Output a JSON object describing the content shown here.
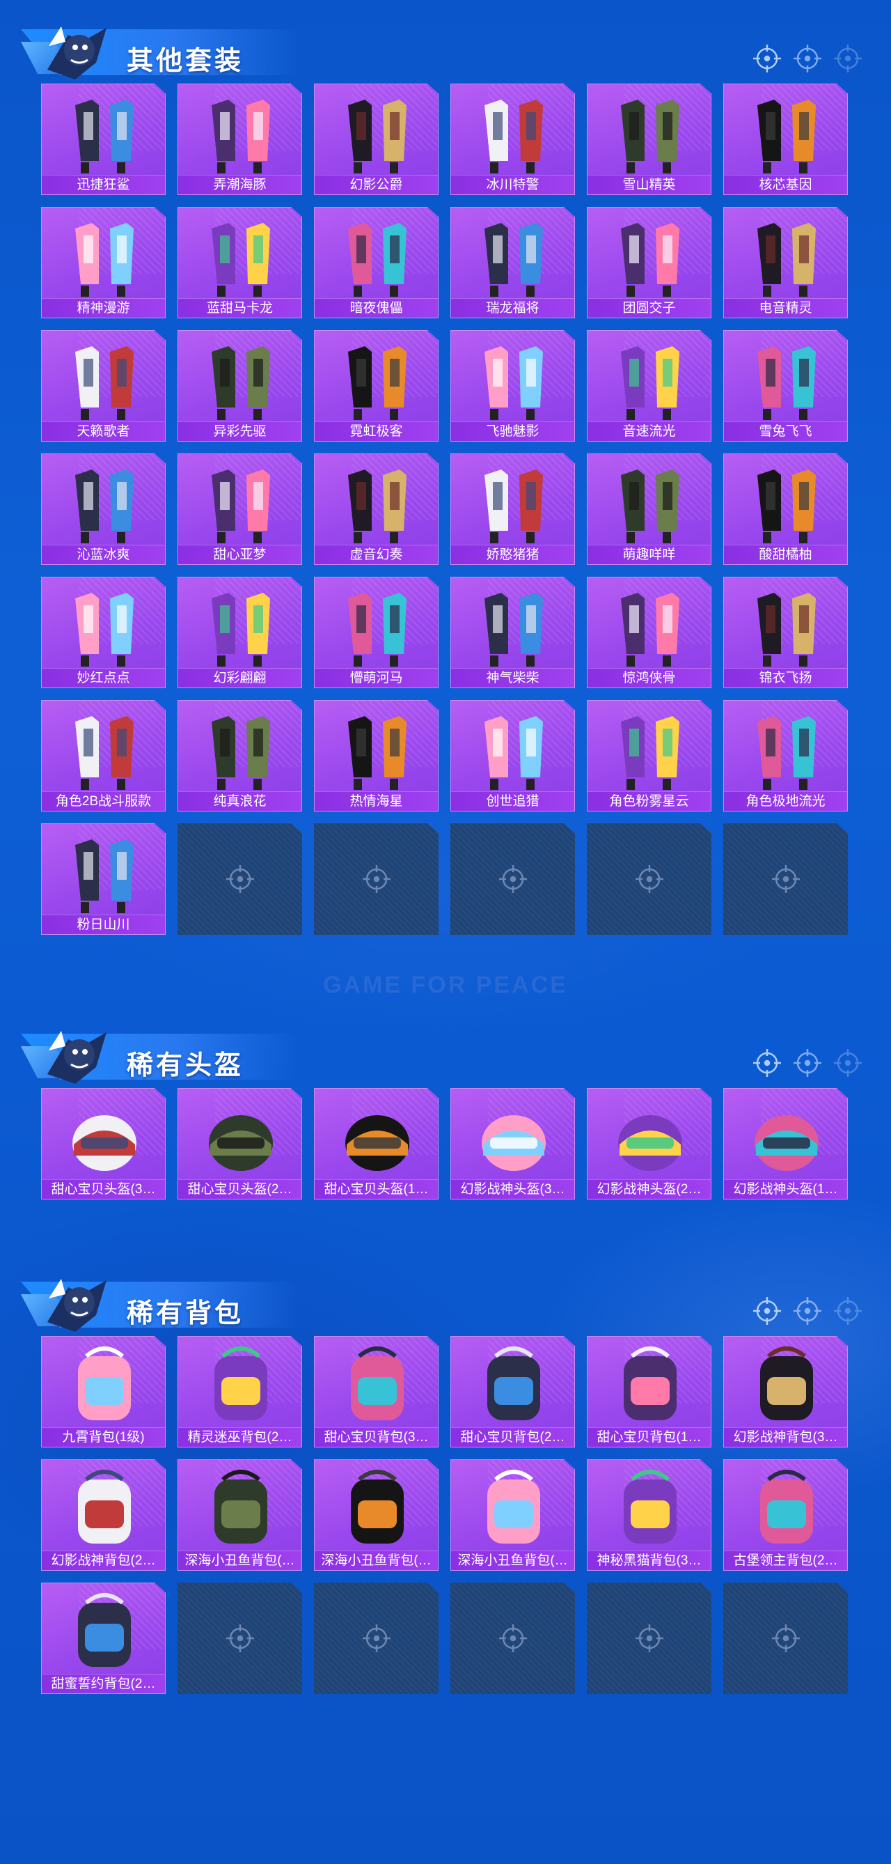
{
  "colors": {
    "background": "#0b58cf",
    "card": "#a24ef0",
    "label": "#8b2fe3",
    "empty": "#1f4477"
  },
  "watermark": {
    "subtitle": "GAME FOR PEACE"
  },
  "sections": [
    {
      "title": "其他套装",
      "icon": "crosshair-icon",
      "items": [
        "迅捷狂鲨",
        "弄潮海豚",
        "幻影公爵",
        "冰川特警",
        "雪山精英",
        "核芯基因",
        "精神漫游",
        "蓝甜马卡龙",
        "暗夜傀儡",
        "瑞龙福将",
        "团圆交子",
        "电音精灵",
        "天籁歌者",
        "异彩先驱",
        "霓虹极客",
        "飞驰魅影",
        "音速流光",
        "雪兔飞飞",
        "沁蓝冰爽",
        "甜心亚梦",
        "虚音幻奏",
        "娇憨猪猪",
        "萌趣咩咩",
        "酸甜橘柚",
        "妙红点点",
        "幻彩翩翩",
        "懵萌河马",
        "神气柴柴",
        "惊鸿侠骨",
        "锦衣飞扬",
        "角色2B战斗服款",
        "纯真浪花",
        "热情海星",
        "创世追猎",
        "角色粉雾星云",
        "角色极地流光",
        "粉日山川"
      ],
      "empty_slots": 5
    },
    {
      "title": "稀有头盔",
      "icon": "crosshair-icon",
      "items": [
        "甜心宝贝头盔(3…",
        "甜心宝贝头盔(2…",
        "甜心宝贝头盔(1…",
        "幻影战神头盔(3…",
        "幻影战神头盔(2…",
        "幻影战神头盔(1…"
      ],
      "empty_slots": 0
    },
    {
      "title": "稀有背包",
      "icon": "crosshair-icon",
      "items": [
        "九霄背包(1级)",
        "精灵迷巫背包(2…",
        "甜心宝贝背包(3…",
        "甜心宝贝背包(2…",
        "甜心宝贝背包(1…",
        "幻影战神背包(3…",
        "幻影战神背包(2…",
        "深海小丑鱼背包(…",
        "深海小丑鱼背包(…",
        "深海小丑鱼背包(…",
        "神秘黑猫背包(3…",
        "古堡领主背包(2…",
        "甜蜜誓约背包(2…"
      ],
      "empty_slots": 5
    }
  ]
}
